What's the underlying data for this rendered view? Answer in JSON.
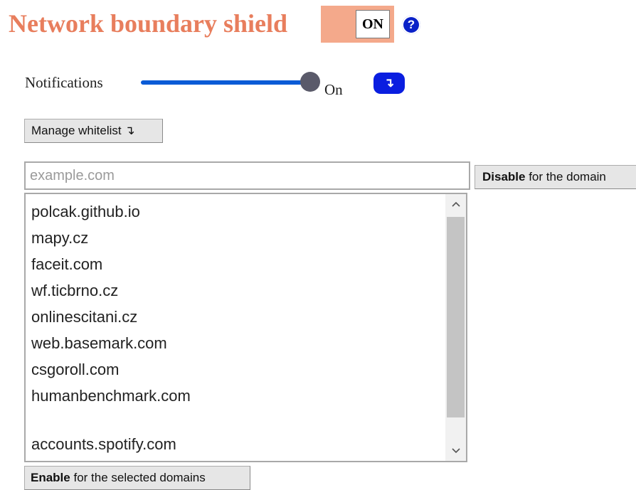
{
  "header": {
    "title": "Network boundary shield",
    "toggle_label": "ON",
    "help_icon": "?"
  },
  "notifications": {
    "label": "Notifications",
    "value_label": "On",
    "slider_fraction": 1.0,
    "action_icon": "↴"
  },
  "whitelist": {
    "manage_label": "Manage whitelist ↴",
    "input_placeholder": "example.com",
    "input_value": "",
    "disable_bold": "Disable",
    "disable_rest": " for the domain",
    "domains": [
      "polcak.github.io",
      "mapy.cz",
      "faceit.com",
      "wf.ticbrno.cz",
      "onlinescitani.cz",
      "web.basemark.com",
      "csgoroll.com",
      "humanbenchmark.com",
      "",
      "accounts.spotify.com"
    ],
    "enable_bold": "Enable",
    "enable_rest": " for the selected domains"
  },
  "colors": {
    "title": "#e87e5d",
    "toggle_bg": "#f4a98b",
    "accent_blue": "#0a1ee0",
    "slider_blue": "#0a5bd6"
  },
  "icons": {
    "help": "question-circle-icon",
    "notif_action": "return-arrow-icon",
    "scroll_up": "chevron-up-icon",
    "scroll_down": "chevron-down-icon"
  }
}
